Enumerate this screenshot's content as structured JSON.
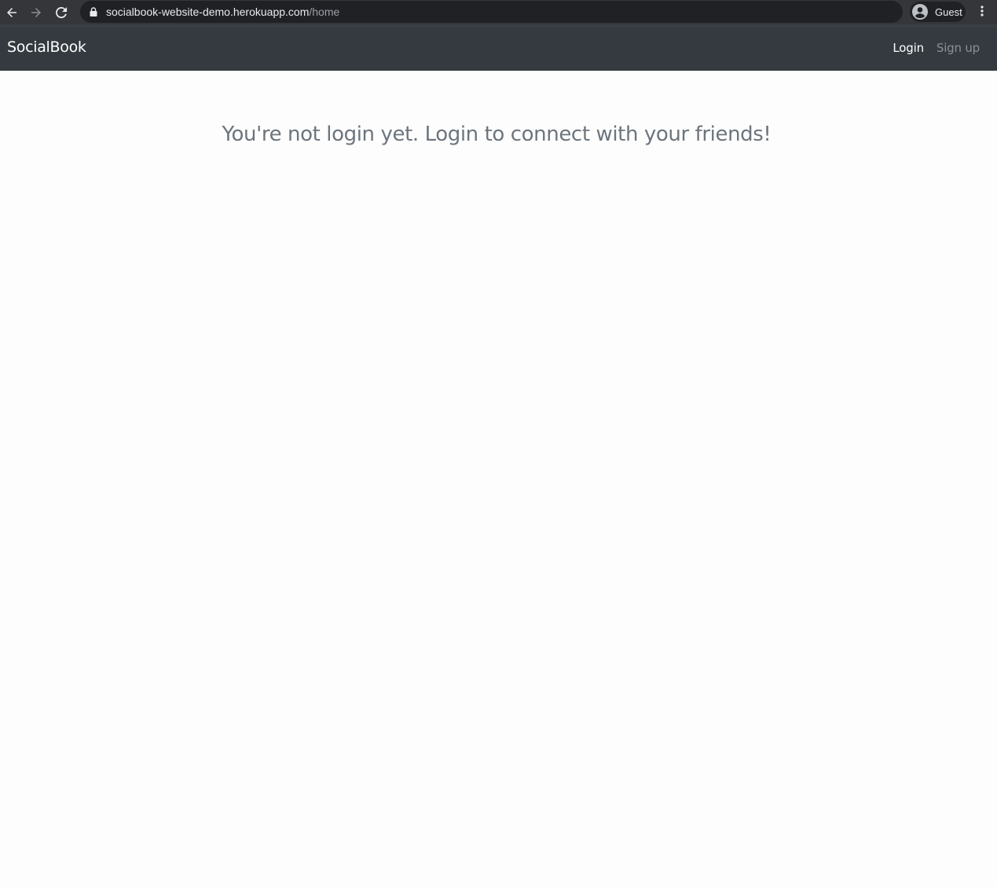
{
  "browser": {
    "url_host": "socialbook-website-demo.herokuapp.com",
    "url_path": "/home",
    "profile_label": "Guest",
    "icons": {
      "back": "arrow-left-icon",
      "forward": "arrow-right-icon",
      "reload": "reload-icon",
      "lock": "lock-icon",
      "avatar": "account-circle-icon",
      "menu": "kebab-menu-icon"
    }
  },
  "navbar": {
    "brand": "SocialBook",
    "links": [
      {
        "label": "Login",
        "state": "active"
      },
      {
        "label": "Sign up",
        "state": "muted"
      }
    ],
    "background": "#343a40"
  },
  "main": {
    "message": "You're not login yet. Login to connect with your friends!",
    "message_color": "#6c757d"
  }
}
